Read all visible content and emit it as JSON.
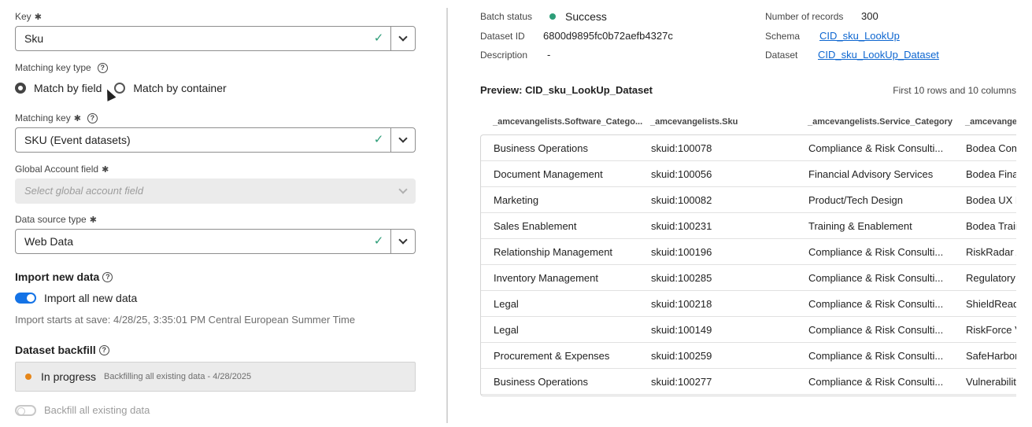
{
  "form": {
    "key_label": "Key",
    "key_value": "Sku",
    "matching_key_type_label": "Matching key type",
    "radio_field_label": "Match by field",
    "radio_container_label": "Match by container",
    "matching_key_label": "Matching key",
    "matching_key_value": "SKU (Event datasets)",
    "global_account_label": "Global Account field",
    "global_account_placeholder": "Select global account field",
    "data_source_label": "Data source type",
    "data_source_value": "Web Data",
    "required_mark": "✱",
    "help_glyph": "?",
    "check_glyph": "✓"
  },
  "import": {
    "title": "Import new data",
    "toggle_label": "Import all new data",
    "toggle_on": true,
    "note": "Import starts at save: 4/28/25, 3:35:01 PM Central European Summer Time"
  },
  "backfill": {
    "title": "Dataset backfill",
    "status": "In progress",
    "status_detail": "Backfilling all existing data - 4/28/2025",
    "status_color": "#e68619",
    "toggle_label": "Backfill all existing data",
    "toggle_on": false
  },
  "meta": {
    "batch_status_label": "Batch status",
    "batch_status_value": "Success",
    "batch_status_color": "#2d9d78",
    "dataset_id_label": "Dataset ID",
    "dataset_id_value": "6800d9895fc0b72aefb4327c",
    "description_label": "Description",
    "description_value": "-",
    "records_label": "Number of records",
    "records_value": "300",
    "schema_label": "Schema",
    "schema_value": "CID_sku_LookUp",
    "dataset_label": "Dataset",
    "dataset_value": "CID_sku_LookUp_Dataset"
  },
  "preview": {
    "title": "Preview: CID_sku_LookUp_Dataset",
    "subtitle": "First 10 rows and 10 columns",
    "columns": [
      "_amcevangelists.Software_Catego...",
      "_amcevangelists.Sku",
      "_amcevangelists.Service_Category",
      "_amcevangelists"
    ],
    "rows": [
      [
        "Business Operations",
        "skuid:100078",
        "Compliance & Risk Consulti...",
        "Bodea Com"
      ],
      [
        "Document Management",
        "skuid:100056",
        "Financial Advisory Services",
        "Bodea Fina"
      ],
      [
        "Marketing",
        "skuid:100082",
        "Product/Tech Design",
        "Bodea UX D"
      ],
      [
        "Sales Enablement",
        "skuid:100231",
        "Training & Enablement",
        "Bodea Train"
      ],
      [
        "Relationship Management",
        "skuid:100196",
        "Compliance & Risk Consulti...",
        "RiskRadar A"
      ],
      [
        "Inventory Management",
        "skuid:100285",
        "Compliance & Risk Consulti...",
        "Regulatory"
      ],
      [
        "Legal",
        "skuid:100218",
        "Compliance & Risk Consulti...",
        "ShieldRead"
      ],
      [
        "Legal",
        "skuid:100149",
        "Compliance & Risk Consulti...",
        "RiskForce V"
      ],
      [
        "Procurement & Expenses",
        "skuid:100259",
        "Compliance & Risk Consulti...",
        "SafeHarbor"
      ],
      [
        "Business Operations",
        "skuid:100277",
        "Compliance & Risk Consulti...",
        "Vulnerabilit"
      ]
    ]
  }
}
